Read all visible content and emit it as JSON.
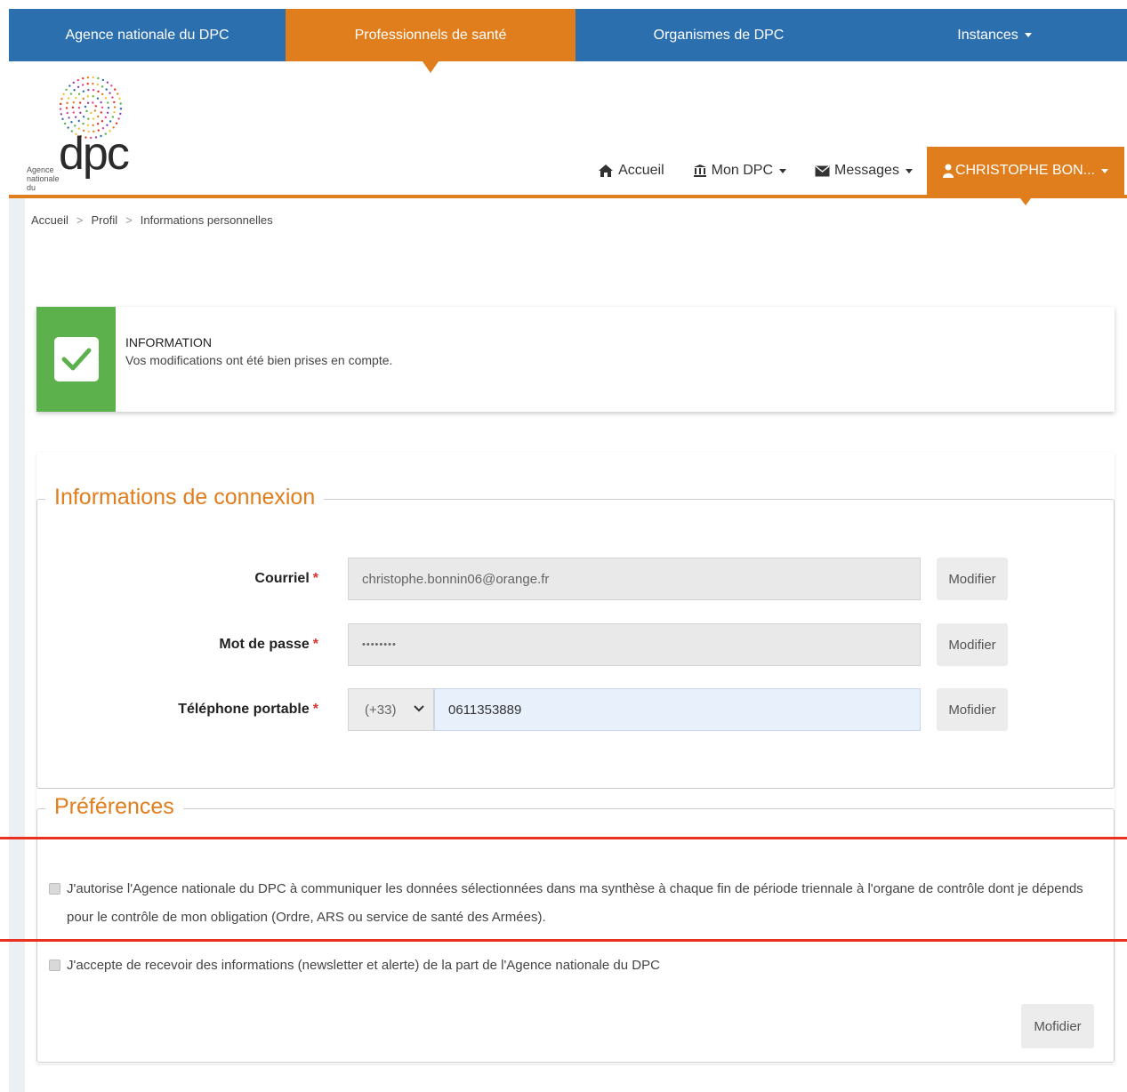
{
  "topnav": {
    "items": [
      {
        "label": "Agence nationale du DPC"
      },
      {
        "label": "Professionnels de santé"
      },
      {
        "label": "Organismes de DPC"
      },
      {
        "label": "Instances"
      }
    ]
  },
  "logo": {
    "wordmark": "dpc",
    "small_text": "Agence nationale du"
  },
  "secnav": {
    "home": "Accueil",
    "mon_dpc": "Mon DPC",
    "messages": "Messages",
    "user": "CHRISTOPHE BON..."
  },
  "breadcrumb": {
    "items": [
      "Accueil",
      "Profil",
      "Informations personnelles"
    ]
  },
  "alert": {
    "title": "INFORMATION",
    "message": "Vos modifications ont été bien prises en compte."
  },
  "connexion": {
    "legend": "Informations de connexion",
    "email_label": "Courriel",
    "email_value": "christophe.bonnin06@orange.fr",
    "email_button": "Modifier",
    "password_label": "Mot de passe",
    "password_value": "••••••••",
    "password_button": "Modifier",
    "phone_label": "Téléphone portable",
    "phone_prefix": "(+33)",
    "phone_value": "0611353889",
    "phone_button": "Mofidier",
    "required_mark": "*"
  },
  "preferences": {
    "legend": "Préférences",
    "consent_1": "J'autorise l'Agence nationale du DPC à communiquer les données sélectionnées dans ma synthèse à chaque fin de période triennale à l'organe de contrôle dont je dépends pour le contrôle de mon obligation (Ordre, ARS ou service de santé des Armées).",
    "consent_2": "J'accepte de recevoir des informations (newsletter et alerte) de la part de l'Agence nationale du DPC",
    "submit_button": "Mofidier"
  },
  "colors": {
    "brand_blue": "#2c6fae",
    "brand_orange": "#e07d1d",
    "success_green": "#5cb14d",
    "annotation_red": "#e8311f"
  }
}
